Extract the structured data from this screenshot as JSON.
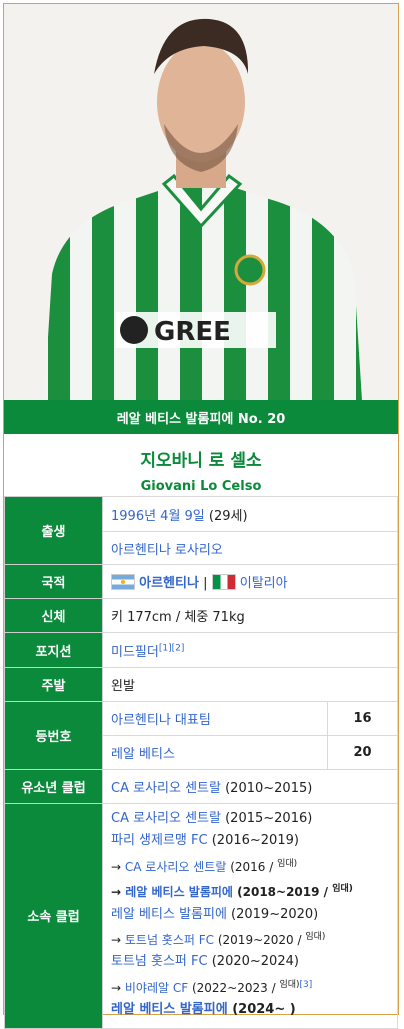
{
  "photo_alt": "Giovani Lo Celso in Real Betis kit",
  "banner": "레알 베티스 발롬피에 No. 20",
  "name_ko": "지오바니 로 셀소",
  "name_en": "Giovani Lo Celso",
  "colors": {
    "header_green": "#0a8a3a",
    "link": "#3366cc",
    "border": "#d8a24a"
  },
  "birth": {
    "label": "출생",
    "date": "1996년 4월 9일",
    "age": "(29세)",
    "place": "아르헨티나 로사리오"
  },
  "nationality": {
    "label": "국적",
    "primary": "아르헨티나",
    "separator": "|",
    "secondary": "이탈리아"
  },
  "body": {
    "label": "신체",
    "text": "키 177cm / 체중 71kg"
  },
  "position": {
    "label": "포지션",
    "value": "미드필더",
    "ref": "[1][2]"
  },
  "foot": {
    "label": "주발",
    "value": "왼발"
  },
  "number": {
    "label": "등번호",
    "rows": [
      {
        "team": "아르헨티나 대표팀",
        "num": "16"
      },
      {
        "team": "레알 베티스",
        "num": "20"
      }
    ]
  },
  "youth": {
    "label": "유소년 클럽",
    "club": "CA 로사리오 센트랄",
    "years": "(2010~2015)"
  },
  "clubs": {
    "label": "소속 클럽",
    "items": [
      {
        "prefix": "",
        "name": "CA 로사리오 센트랄",
        "years": "(2015~2016)",
        "note": ""
      },
      {
        "prefix": "",
        "name": "파리 생제르맹 FC",
        "years": "(2016~2019)",
        "note": ""
      },
      {
        "prefix": "→ ",
        "name": "CA 로사리오 센트랄",
        "years": "(2016 /",
        "note": "임대)"
      },
      {
        "prefix": "→ ",
        "name": "레알 베티스 발롬피에",
        "years": "(2018~2019 /",
        "note": "임대)"
      },
      {
        "prefix": "",
        "name": "레알 베티스 발롬피에",
        "years": "(2019~2020)",
        "note": ""
      },
      {
        "prefix": "→ ",
        "name": "토트넘 홋스퍼 FC",
        "years": "(2019~2020 /",
        "note": "임대)"
      },
      {
        "prefix": "",
        "name": "토트넘 홋스퍼 FC",
        "years": "(2020~2024)",
        "note": ""
      },
      {
        "prefix": "→ ",
        "name": "비야레알 CF",
        "years": "(2022~2023 /",
        "note": "임대)",
        "ref": "[3]"
      },
      {
        "prefix": "",
        "name": "레알 베티스 발롬피에",
        "years": "(2024~ )",
        "note": ""
      }
    ]
  }
}
